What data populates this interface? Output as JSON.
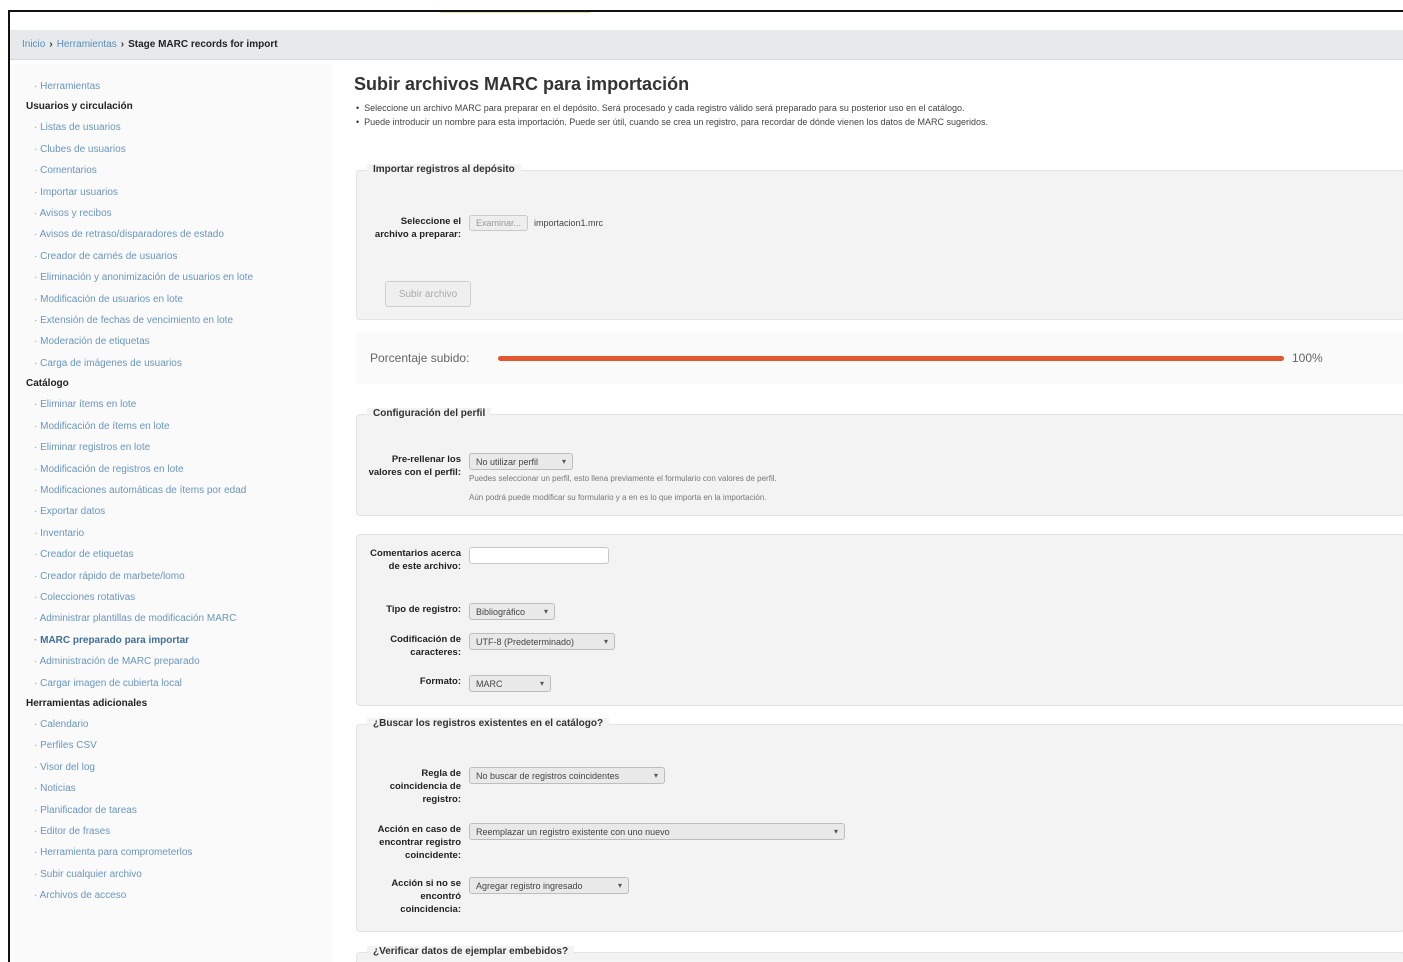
{
  "breadcrumb": {
    "home": "Inicio",
    "tools": "Herramientas",
    "current": "Stage MARC records for import"
  },
  "sidebar": {
    "top_item": "Herramientas",
    "sections": [
      {
        "heading": "Usuarios y circulación",
        "items": [
          "Listas de usuarios",
          "Clubes de usuarios",
          "Comentarios",
          "Importar usuarios",
          "Avisos y recibos",
          "Avisos de retraso/disparadores de estado",
          "Creador de carnés de usuarios",
          "Eliminación y anonimización de usuarios en lote",
          "Modificación de usuarios en lote",
          "Extensión de fechas de vencimiento en lote",
          "Moderación de etiquetas",
          "Carga de imágenes de usuarios"
        ]
      },
      {
        "heading": "Catálogo",
        "items": [
          "Eliminar ítems en lote",
          "Modificación de ítems en lote",
          "Eliminar registros en lote",
          "Modificación de registros en lote",
          "Modificaciones automáticas de ítems por edad",
          "Exportar datos",
          "Inventario",
          "Creador de etiquetas",
          "Creador rápido de marbete/lomo",
          "Colecciones rotativas",
          "Administrar plantillas de modificación MARC",
          "MARC preparado para importar",
          "Administración de MARC preparado",
          "Cargar imagen de cubierta local"
        ]
      },
      {
        "heading": "Herramientas adicionales",
        "items": [
          "Calendario",
          "Perfiles CSV",
          "Visor del log",
          "Noticias",
          "Planificador de tareas",
          "Editor de frases",
          "Herramienta para comprometerlos",
          "Subir cualquier archivo",
          "Archivos de acceso"
        ]
      }
    ],
    "active_item": "MARC preparado para importar"
  },
  "main": {
    "title": "Subir archivos MARC para importación",
    "hints": [
      "Seleccione un archivo MARC para preparar en el depósito. Será procesado y cada registro válido será preparado para su posterior uso en el catálogo.",
      "Puede introducir un nombre para esta importación. Puede ser útil, cuando se crea un registro, para recordar de dónde vienen los datos de MARC sugeridos."
    ]
  },
  "import_section": {
    "legend": "Importar registros al depósito",
    "file_label": "Seleccione el archivo a preparar:",
    "browse_label": "Examinar...",
    "filename": "importacion1.mrc",
    "upload_button": "Subir archivo"
  },
  "progress": {
    "label": "Porcentaje subido:",
    "percent_text": "100%",
    "percent_value": 100,
    "color": "#e2572d"
  },
  "profile_section": {
    "legend": "Configuración del perfil",
    "prefill_label": "Pre-rellenar los valores con el perfil:",
    "prefill_value": "No utilizar perfil",
    "help1": "Puedes seleccionar un perfil, esto llena previamente el formulario con valores de perfil.",
    "help2": "Aún podrá puede modificar su formulario y a en es lo que importa en la importación."
  },
  "options_section": {
    "comments_label": "Comentarios acerca de este archivo:",
    "comments_value": "",
    "record_type_label": "Tipo de registro:",
    "record_type_value": "Bibliográfico",
    "encoding_label": "Codificación de caracteres:",
    "encoding_value": "UTF-8 (Predeterminado)",
    "format_label": "Formato:",
    "format_value": "MARC"
  },
  "match_section": {
    "legend": "¿Buscar los registros existentes en el catálogo?",
    "rule_label": "Regla de coincidencia de registro:",
    "rule_value": "No buscar de registros coincidentes",
    "action_found_label": "Acción en caso de encontrar registro coincidente:",
    "action_found_value": "Reemplazar un registro existente con uno nuevo",
    "action_notfound_label": "Acción si no se encontró coincidencia:",
    "action_notfound_value": "Agregar registro ingresado"
  },
  "verify_section": {
    "legend": "¿Verificar datos de ejemplar embebidos?"
  }
}
